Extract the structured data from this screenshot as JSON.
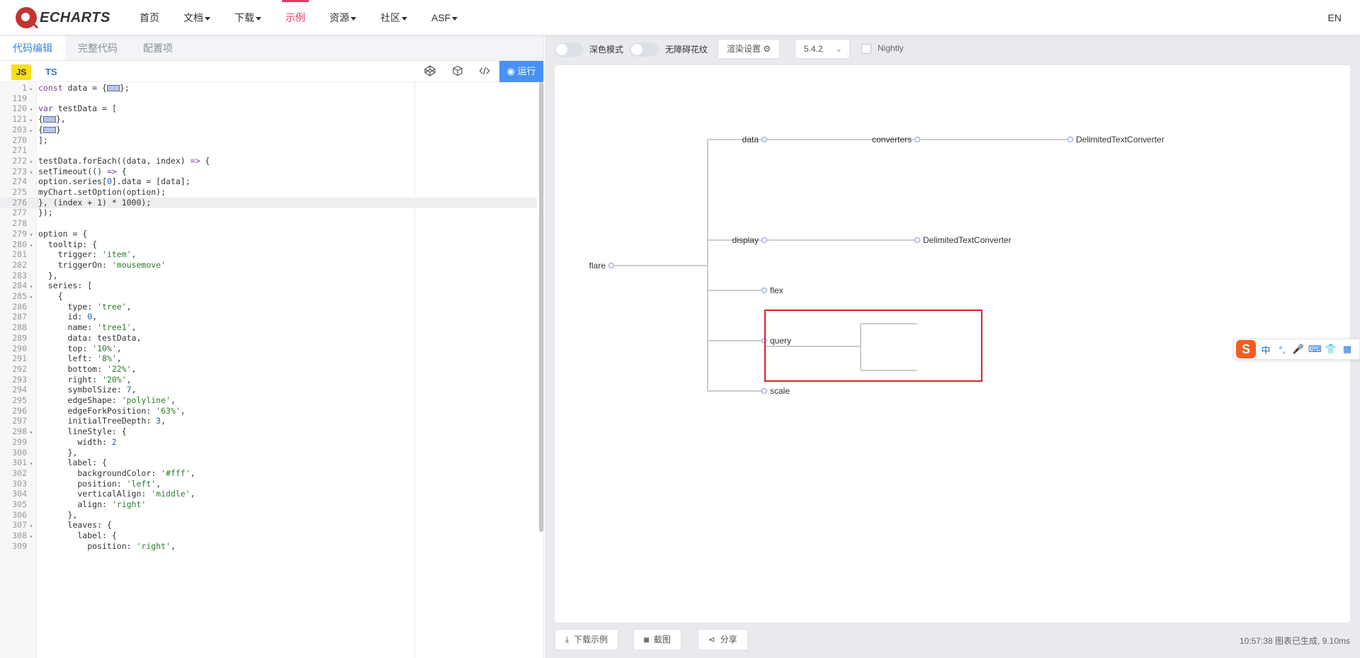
{
  "navbar": {
    "logo_text": "ECHARTS",
    "items": [
      {
        "label": "首页",
        "dropdown": false,
        "active": false
      },
      {
        "label": "文档",
        "dropdown": true,
        "active": false
      },
      {
        "label": "下载",
        "dropdown": true,
        "active": false
      },
      {
        "label": "示例",
        "dropdown": false,
        "active": true
      },
      {
        "label": "资源",
        "dropdown": true,
        "active": false
      },
      {
        "label": "社区",
        "dropdown": true,
        "active": false
      },
      {
        "label": "ASF",
        "dropdown": true,
        "active": false
      }
    ],
    "lang": "EN"
  },
  "editor": {
    "tabs": [
      "代码编辑",
      "完整代码",
      "配置项"
    ],
    "active_tab": 0,
    "lang_js": "JS",
    "lang_ts": "TS",
    "run_label": "运行",
    "highlighted_line": "276",
    "lines": [
      {
        "n": "1",
        "fold": "right",
        "code": "const data = {[box]};"
      },
      {
        "n": "119",
        "fold": "",
        "code": ""
      },
      {
        "n": "120",
        "fold": "down",
        "code": "var testData = ["
      },
      {
        "n": "121",
        "fold": "right",
        "code": "{[box]},"
      },
      {
        "n": "203",
        "fold": "right",
        "code": "{[box]}"
      },
      {
        "n": "270",
        "fold": "",
        "code": "];"
      },
      {
        "n": "271",
        "fold": "",
        "code": ""
      },
      {
        "n": "272",
        "fold": "down",
        "code": "testData.forEach((data, index) => {"
      },
      {
        "n": "273",
        "fold": "down",
        "code": "setTimeout(() => {"
      },
      {
        "n": "274",
        "fold": "",
        "code": "option.series[0].data = [data];"
      },
      {
        "n": "275",
        "fold": "",
        "code": "myChart.setOption(option);"
      },
      {
        "n": "276",
        "fold": "",
        "code": "}, (index + 1) * 1000);"
      },
      {
        "n": "277",
        "fold": "",
        "code": "});"
      },
      {
        "n": "278",
        "fold": "",
        "code": ""
      },
      {
        "n": "279",
        "fold": "down",
        "code": "option = {"
      },
      {
        "n": "280",
        "fold": "down",
        "code": "  tooltip: {"
      },
      {
        "n": "281",
        "fold": "",
        "code": "    trigger: 'item',"
      },
      {
        "n": "282",
        "fold": "",
        "code": "    triggerOn: 'mousemove'"
      },
      {
        "n": "283",
        "fold": "",
        "code": "  },"
      },
      {
        "n": "284",
        "fold": "down",
        "code": "  series: ["
      },
      {
        "n": "285",
        "fold": "down",
        "code": "    {"
      },
      {
        "n": "286",
        "fold": "",
        "code": "      type: 'tree',"
      },
      {
        "n": "287",
        "fold": "",
        "code": "      id: 0,"
      },
      {
        "n": "288",
        "fold": "",
        "code": "      name: 'tree1',"
      },
      {
        "n": "289",
        "fold": "",
        "code": "      data: testData,"
      },
      {
        "n": "290",
        "fold": "",
        "code": "      top: '10%',"
      },
      {
        "n": "291",
        "fold": "",
        "code": "      left: '8%',"
      },
      {
        "n": "292",
        "fold": "",
        "code": "      bottom: '22%',"
      },
      {
        "n": "293",
        "fold": "",
        "code": "      right: '20%',"
      },
      {
        "n": "294",
        "fold": "",
        "code": "      symbolSize: 7,"
      },
      {
        "n": "295",
        "fold": "",
        "code": "      edgeShape: 'polyline',"
      },
      {
        "n": "296",
        "fold": "",
        "code": "      edgeForkPosition: '63%',"
      },
      {
        "n": "297",
        "fold": "",
        "code": "      initialTreeDepth: 3,"
      },
      {
        "n": "298",
        "fold": "down",
        "code": "      lineStyle: {"
      },
      {
        "n": "299",
        "fold": "",
        "code": "        width: 2"
      },
      {
        "n": "300",
        "fold": "",
        "code": "      },"
      },
      {
        "n": "301",
        "fold": "down",
        "code": "      label: {"
      },
      {
        "n": "302",
        "fold": "",
        "code": "        backgroundColor: '#fff',"
      },
      {
        "n": "303",
        "fold": "",
        "code": "        position: 'left',"
      },
      {
        "n": "304",
        "fold": "",
        "code": "        verticalAlign: 'middle',"
      },
      {
        "n": "305",
        "fold": "",
        "code": "        align: 'right'"
      },
      {
        "n": "306",
        "fold": "",
        "code": "      },"
      },
      {
        "n": "307",
        "fold": "down",
        "code": "      leaves: {"
      },
      {
        "n": "308",
        "fold": "down",
        "code": "        label: {"
      },
      {
        "n": "309",
        "fold": "",
        "code": "          position: 'right',"
      }
    ]
  },
  "right_toolbar": {
    "dark_mode_label": "深色模式",
    "accessible_label": "无障碍花纹",
    "render_settings_label": "渲染设置",
    "version": "5.4.2",
    "nightly_label": "Nightly"
  },
  "tree": {
    "root": "flare",
    "nodes": [
      "data",
      "converters",
      "DelimitedTextConverter",
      "display",
      "DelimitedTextConverter",
      "flex",
      "query",
      "scale"
    ],
    "colors": {
      "line": "#cccccc",
      "node": "#a3b6d9",
      "highlight_box": "#e02020"
    }
  },
  "bottom": {
    "download_label": "下载示例",
    "screenshot_label": "截图",
    "share_label": "分享",
    "status": "10:57:38   图表已生成, 9.10ms"
  },
  "ime": {
    "logo": "S",
    "items": [
      "中",
      "°,",
      "🎤",
      "⌨",
      "👕",
      "▦"
    ]
  }
}
